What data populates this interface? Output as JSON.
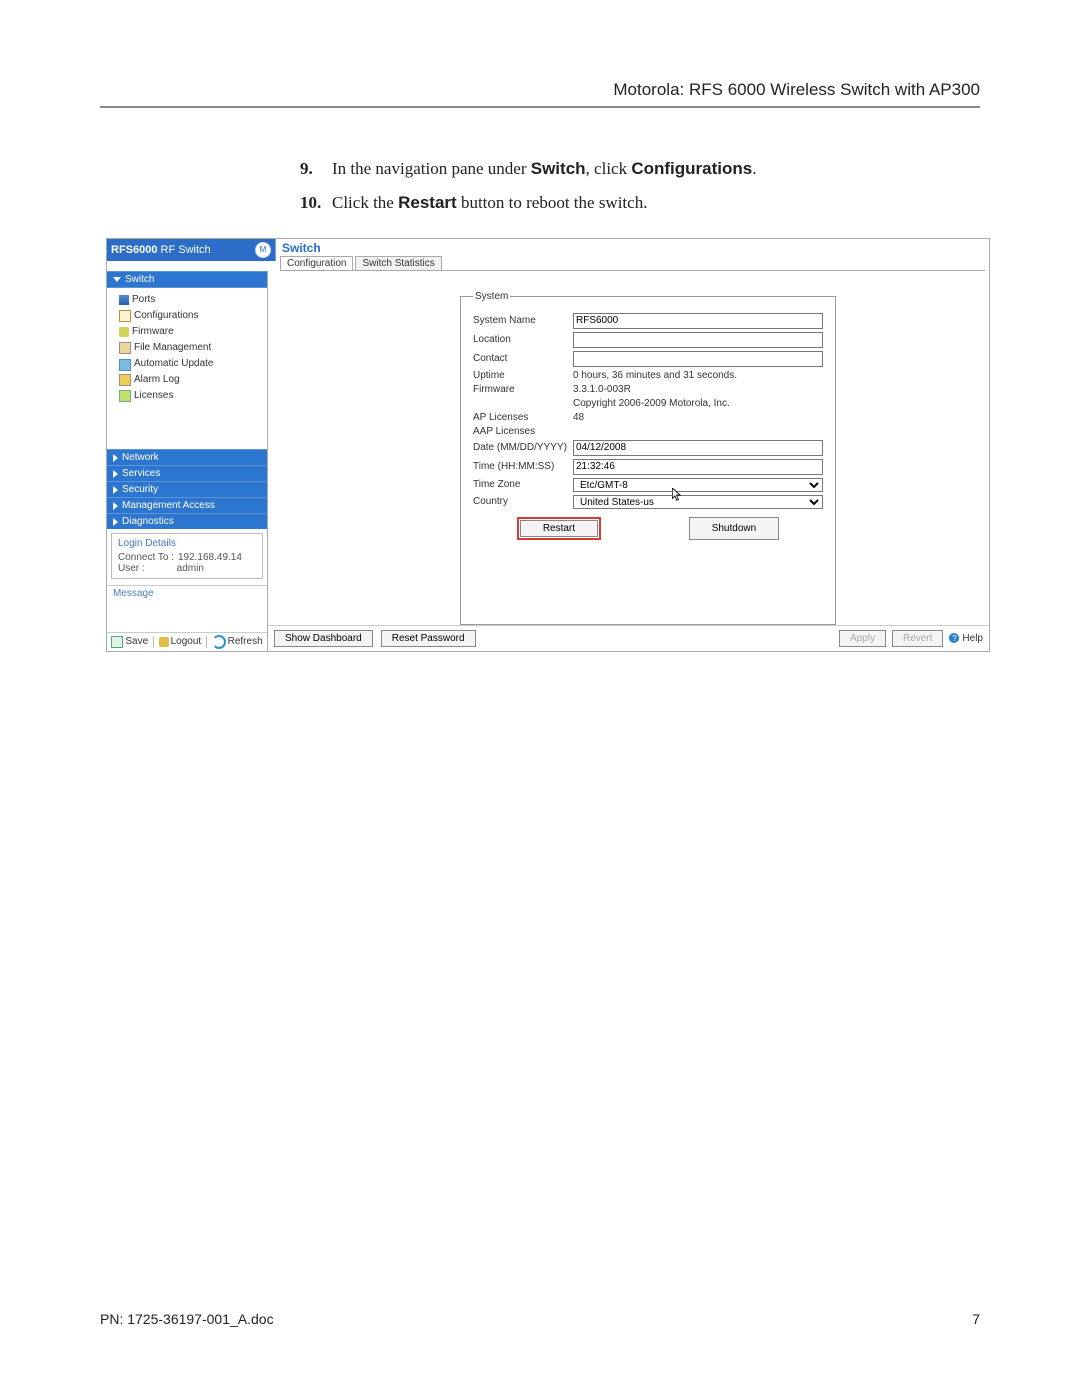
{
  "header": "Motorola: RFS 6000 Wireless Switch with AP300",
  "steps": {
    "s9_num": "9.",
    "s9_a": "In the navigation pane under ",
    "s9_b1": "Switch",
    "s9_c": ", click ",
    "s9_b2": "Configurations",
    "s9_d": ".",
    "s10_num": "10.",
    "s10_a": "Click the ",
    "s10_b": "Restart",
    "s10_c": " button to reboot the switch."
  },
  "app": {
    "brand_a": "RFS6000",
    "brand_b": " RF Switch",
    "logo_hint": "M",
    "title": "Switch",
    "tab1": "Configuration",
    "tab2": "Switch Statistics"
  },
  "sidebar": {
    "switch_label": "Switch",
    "tree": {
      "ports": "Ports",
      "configs": "Configurations",
      "firmware": "Firmware",
      "file_mgmt": "File Management",
      "auto_update": "Automatic Update",
      "alarm_log": "Alarm Log",
      "licenses": "Licenses"
    },
    "sections": {
      "network": "Network",
      "services": "Services",
      "security": "Security",
      "mgmt": "Management Access",
      "diag": "Diagnostics"
    },
    "login": {
      "title": "Login Details",
      "connect_label": "Connect To :",
      "connect_val": "192.168.49.14",
      "user_label": "User :",
      "user_val": "admin"
    },
    "message": "Message",
    "footer": {
      "save": "Save",
      "logout": "Logout",
      "refresh": "Refresh"
    }
  },
  "form": {
    "legend": "System",
    "labels": {
      "name": "System Name",
      "loc": "Location",
      "contact": "Contact",
      "uptime": "Uptime",
      "firmware": "Firmware",
      "aplic": "AP Licenses",
      "aaplic": "AAP Licenses",
      "date": "Date (MM/DD/YYYY)",
      "time": "Time (HH:MM:SS)",
      "tz": "Time Zone",
      "country": "Country"
    },
    "values": {
      "name": "RFS6000",
      "loc": "",
      "contact": "",
      "uptime": "0 hours, 36 minutes and 31 seconds.",
      "firmware": "3.3.1.0-003R",
      "copyright": "Copyright 2006-2009 Motorola, Inc.",
      "aplic": "48",
      "aaplic": "",
      "date": "04/12/2008",
      "time": "21:32:46",
      "tz": "Etc/GMT-8",
      "country": "United States-us"
    },
    "buttons": {
      "restart": "Restart",
      "shutdown": "Shutdown"
    }
  },
  "bottombar": {
    "show_dash": "Show Dashboard",
    "reset_pw": "Reset Password",
    "apply": "Apply",
    "revert": "Revert",
    "help": "Help"
  },
  "pagefoot": {
    "pn": "PN: 1725-36197-001_A.doc",
    "num": "7"
  }
}
